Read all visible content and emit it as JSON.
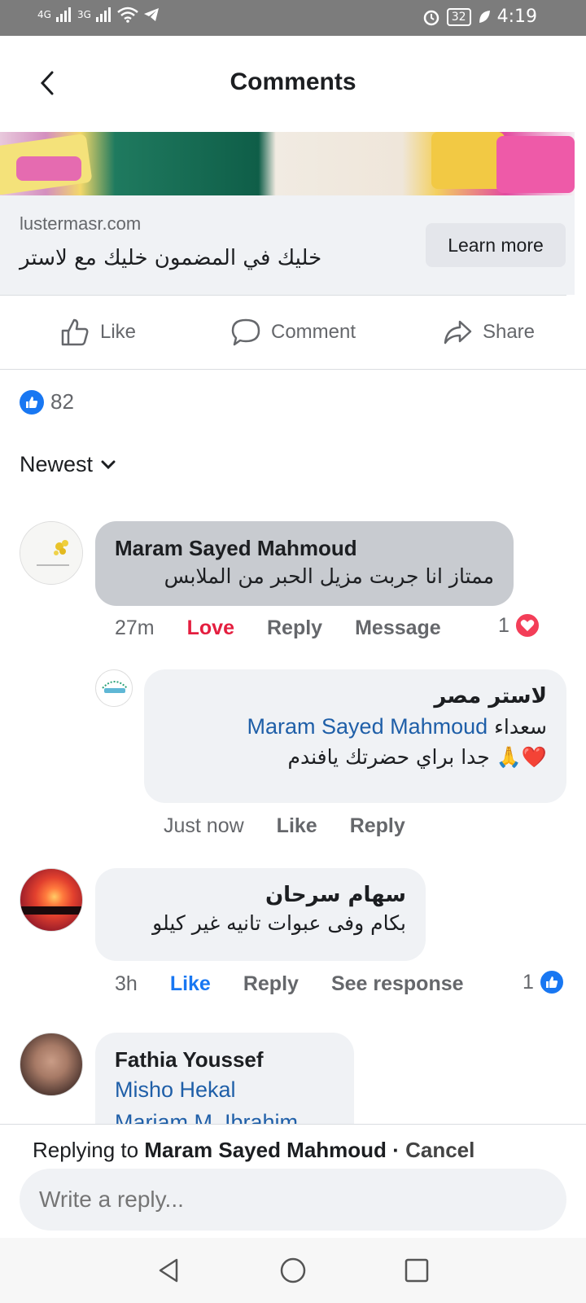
{
  "status_bar": {
    "signal_1": "4G",
    "signal_2": "3G",
    "battery": "32",
    "time": "4:19"
  },
  "header": {
    "title": "Comments"
  },
  "ad": {
    "domain": "lustermasr.com",
    "headline": "خليك في المضمون خليك مع لاستر",
    "cta": "Learn more"
  },
  "actions": {
    "like": "Like",
    "comment": "Comment",
    "share": "Share"
  },
  "reactions": {
    "count": "82"
  },
  "sort": {
    "label": "Newest"
  },
  "comments": [
    {
      "name": "Maram Sayed Mahmoud",
      "text": "ممتاز انا جربت مزيل الحبر من الملابس",
      "time": "27m",
      "reaction_label": "Love",
      "reply": "Reply",
      "message": "Message",
      "reaction_count": "1",
      "reaction_type": "love"
    },
    {
      "name": "لاستر مصر",
      "mention": "Maram Sayed Mahmoud",
      "text_1": "سعداء",
      "text_2": "جدا براي حضرتك يافندم",
      "emoji": "🙏❤️",
      "time": "Just now",
      "like": "Like",
      "reply": "Reply"
    },
    {
      "name": "سهام سرحان",
      "text": "بكام وفى عبوات تانيه غير كيلو",
      "time": "3h",
      "like": "Like",
      "reply": "Reply",
      "see_response": "See response",
      "reaction_count": "1",
      "reaction_type": "like"
    },
    {
      "name": "Fathia Youssef",
      "mention_1": "Misho Hekal",
      "mention_2": "Mariam M. Ibrahim"
    }
  ],
  "reply_bar": {
    "prefix": "Replying to",
    "target": "Maram Sayed Mahmoud",
    "separator": "·",
    "cancel": "Cancel",
    "placeholder": "Write a reply..."
  },
  "colors": {
    "link_blue": "#1877f2",
    "love_red": "#e41e3f",
    "bubble_gray": "#f0f2f5"
  }
}
